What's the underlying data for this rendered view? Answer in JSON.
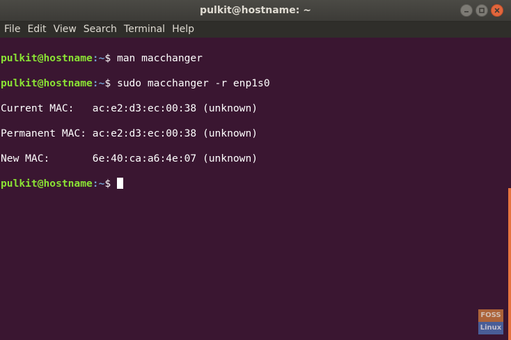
{
  "window": {
    "title": "pulkit@hostname: ~"
  },
  "menu": {
    "items": [
      "File",
      "Edit",
      "View",
      "Search",
      "Terminal",
      "Help"
    ]
  },
  "terminal": {
    "prompt_user": "pulkit@hostname",
    "prompt_path": ":~",
    "prompt_symbol": "$ ",
    "commands": [
      "man macchanger",
      "sudo macchanger -r enp1s0"
    ],
    "output": [
      "Current MAC:   ac:e2:d3:ec:00:38 (unknown)",
      "Permanent MAC: ac:e2:d3:ec:00:38 (unknown)",
      "New MAC:       6e:40:ca:a6:4e:07 (unknown)"
    ]
  },
  "watermark": {
    "top": "FOSS",
    "bottom": "Linux"
  },
  "colors": {
    "terminal_bg": "#3a1631",
    "prompt_user": "#8ae234",
    "prompt_path": "#729fcf",
    "close_button": "#e2663c",
    "scroll_thumb": "#e6743f"
  }
}
